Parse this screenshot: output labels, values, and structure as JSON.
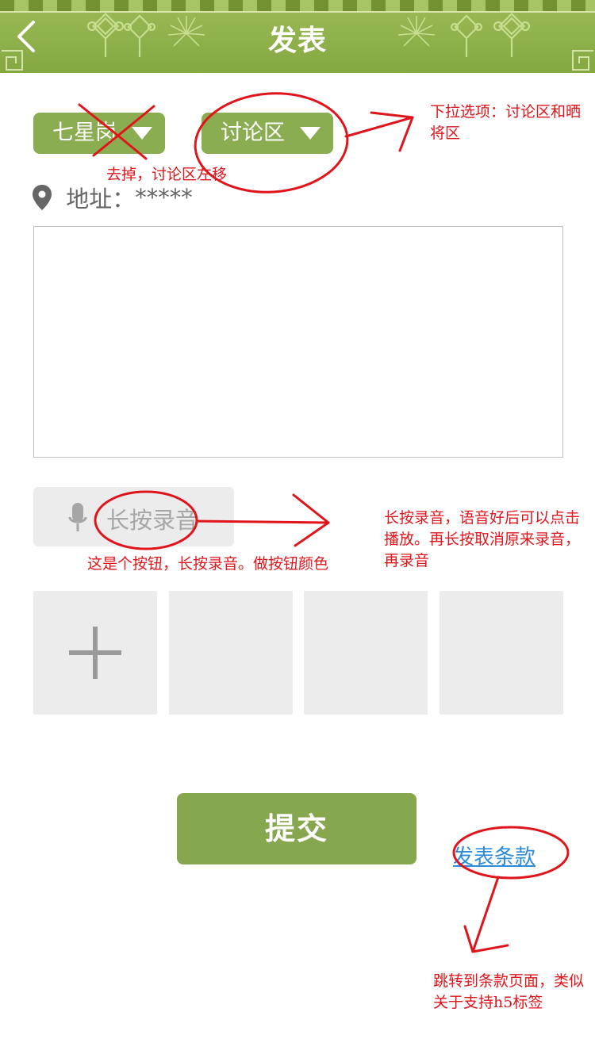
{
  "header": {
    "title": "发表",
    "background_color": "#8aad4c",
    "back_icon": "chevron-left-icon"
  },
  "category": {
    "left_select_label": "七星岗",
    "right_select_label": "讨论区",
    "caret_icon": "triangle-down-icon",
    "button_color": "#8aad51"
  },
  "address": {
    "label": "地址：",
    "value": "*****",
    "icon": "location-pin-icon"
  },
  "content": {
    "value": ""
  },
  "voice": {
    "label": "长按录音",
    "icon": "microphone-icon"
  },
  "images": {
    "add_icon": "plus-icon",
    "slot_count": 4
  },
  "submit": {
    "label": "提交"
  },
  "terms": {
    "label": "发表条款"
  },
  "annotations": {
    "dropdown_note": "下拉选项：讨论区和晒将区",
    "remove_note": "去掉，讨论区左移",
    "button_note": "这是个按钮，长按录音。做按钮颜色",
    "record_note": "长按录音，语音好后可以点击播放。再长按取消原来录音，再录音",
    "terms_note": "跳转到条款页面，类似关于支持h5标签",
    "annotation_color": "#e0151b"
  }
}
